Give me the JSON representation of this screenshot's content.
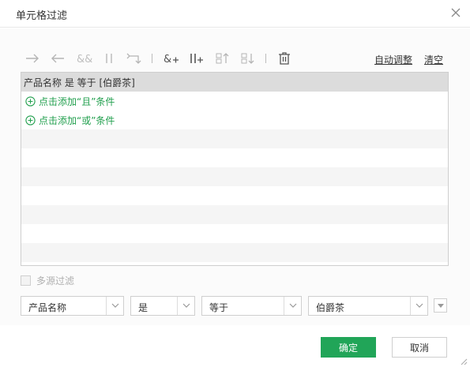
{
  "dialog": {
    "title": "单元格过滤",
    "close_icon": "close-icon"
  },
  "toolbar": {
    "icons": [
      "arrow-right-icon",
      "arrow-left-icon",
      "and-icon",
      "or-icon",
      "swap-icon",
      "add-and-icon",
      "add-or-icon",
      "move-up-icon",
      "move-down-icon",
      "trash-icon"
    ],
    "auto_adjust": "自动调整",
    "clear": "清空"
  },
  "filter": {
    "condition": "产品名称 是 等于 [伯爵茶]",
    "add_and": "点击添加“且”条件",
    "add_or": "点击添加“或”条件"
  },
  "multi_source": {
    "label": "多源过滤",
    "checked": false
  },
  "editor": {
    "field": "产品名称",
    "operator": "是",
    "relation": "等于",
    "value": "伯爵茶"
  },
  "buttons": {
    "ok": "确定",
    "cancel": "取消"
  },
  "colors": {
    "accent": "#21a558",
    "add_link": "#23a04f",
    "selected_row": "#dcdcdc",
    "stripe": "#f5f5f5"
  }
}
